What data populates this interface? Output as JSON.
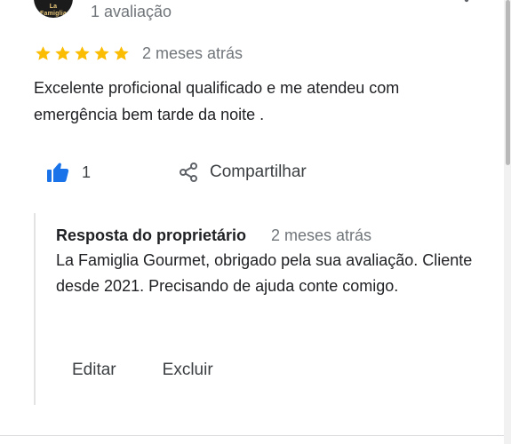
{
  "review": {
    "reviewer_logo_text": "La Famiglia",
    "review_count": "1 avaliação",
    "rating": 5,
    "rating_max": 5,
    "date": "2 meses atrás",
    "text": "Excelente proficional qualificado e me atendeu com emergência bem tarde da noite .",
    "likes": "1",
    "share_label": "Compartilhar",
    "more_icon": "more-vert-icon",
    "like_icon": "thumbs-up-icon",
    "share_icon": "share-icon",
    "star_color": "#fbbc04",
    "like_color": "#1a73e8"
  },
  "owner_response": {
    "title": "Resposta do proprietário",
    "date": "2 meses atrás",
    "text": "La Famiglia Gourmet, obrigado pela sua avaliação. Cliente desde 2021. Precisando de ajuda conte comigo.",
    "edit_label": "Editar",
    "delete_label": "Excluir"
  }
}
